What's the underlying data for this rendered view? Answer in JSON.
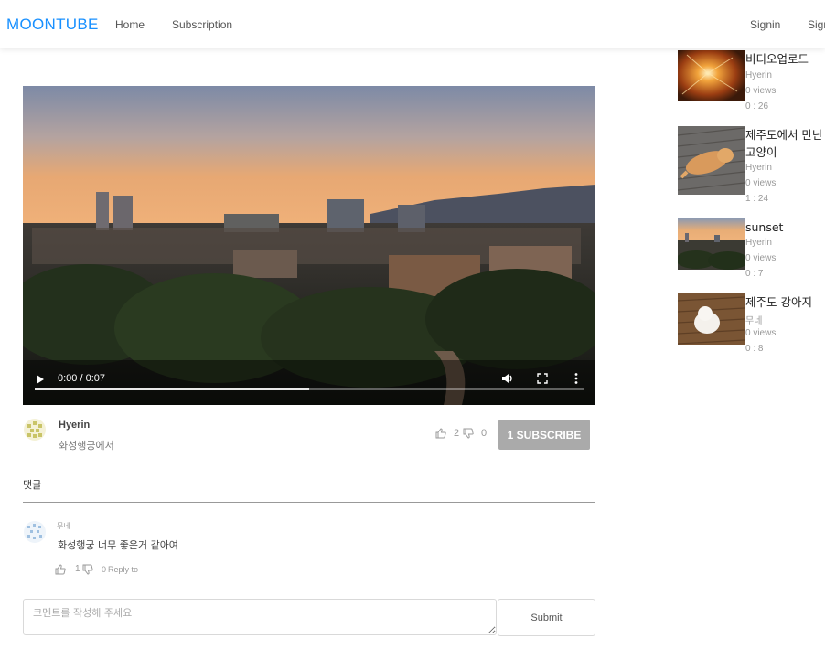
{
  "nav": {
    "brand": "MOONTUBE",
    "links": [
      "Home",
      "Subscription"
    ],
    "right_links": [
      "Signin",
      "Signup"
    ]
  },
  "video": {
    "time_display": "0:00 / 0:07",
    "progress_fraction": 0.5
  },
  "detail": {
    "author": "Hyerin",
    "description": "화성행궁에서",
    "likes": "2",
    "dislikes": "0",
    "subscribe_label": "1 SUBSCRIBE"
  },
  "comments": {
    "title": "댓글",
    "items": [
      {
        "author": "무네",
        "text": "화성행궁 너무 좋은거 같아여",
        "likes": "1",
        "dislikes": "0",
        "reply_label": "Reply to"
      }
    ],
    "placeholder": "코멘트를 작성해 주세요",
    "submit_label": "Submit"
  },
  "sidebar": [
    {
      "title": "비디오업로드",
      "author": "Hyerin",
      "views": "0 views",
      "duration": "0 : 26"
    },
    {
      "title": "제주도에서 만난 고양이",
      "author": "Hyerin",
      "views": "0 views",
      "duration": "1 : 24"
    },
    {
      "title": "sunset",
      "author": "Hyerin",
      "views": "0 views",
      "duration": "0 : 7"
    },
    {
      "title": "제주도 강아지",
      "author": "무네",
      "views": "0 views",
      "duration": "0 : 8"
    }
  ],
  "colors": {
    "brand": "#1890ff",
    "subscribe_bg": "#aaaaaa"
  },
  "icons": [
    "play-icon",
    "volume-icon",
    "fullscreen-icon",
    "more-vert-icon",
    "like-icon",
    "dislike-icon"
  ]
}
